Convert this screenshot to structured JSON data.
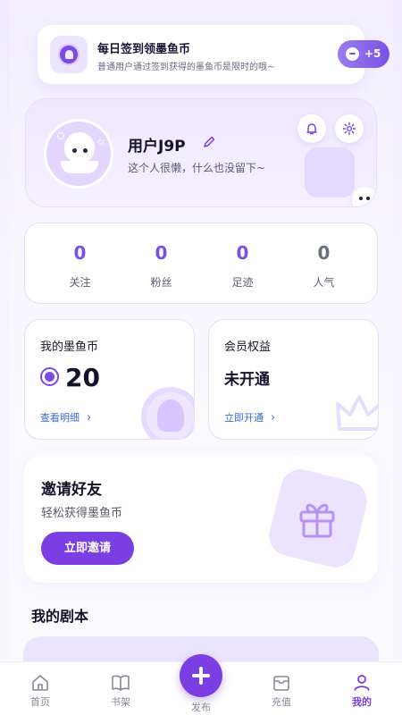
{
  "checkin": {
    "title": "每日签到领墨鱼币",
    "subtitle": "普通用户通过签到获得的墨鱼币是限时的哦~",
    "reward": "+5"
  },
  "profile": {
    "username": "用户J9P",
    "bio": "这个人很懒，什么也没留下~"
  },
  "stats": [
    {
      "value": "0",
      "label": "关注"
    },
    {
      "value": "0",
      "label": "粉丝"
    },
    {
      "value": "0",
      "label": "足迹"
    },
    {
      "value": "0",
      "label": "人气"
    }
  ],
  "coins": {
    "title": "我的墨鱼币",
    "value": "20",
    "link": "查看明细"
  },
  "vip": {
    "title": "会员权益",
    "status": "未开通",
    "link": "立即开通"
  },
  "invite": {
    "title": "邀请好友",
    "subtitle": "轻松获得墨鱼币",
    "button": "立即邀请"
  },
  "scripts": {
    "title": "我的剧本"
  },
  "tabbar": {
    "items": [
      {
        "label": "首页",
        "icon": "home-icon"
      },
      {
        "label": "书架",
        "icon": "book-icon"
      },
      {
        "label": "发布",
        "icon": "plus-icon"
      },
      {
        "label": "充值",
        "icon": "wallet-icon"
      },
      {
        "label": "我的",
        "icon": "user-icon"
      }
    ],
    "active": "我的"
  },
  "colors": {
    "accent": "#7a3ee3",
    "link": "#3b6bdc",
    "background": "#f3efff"
  }
}
